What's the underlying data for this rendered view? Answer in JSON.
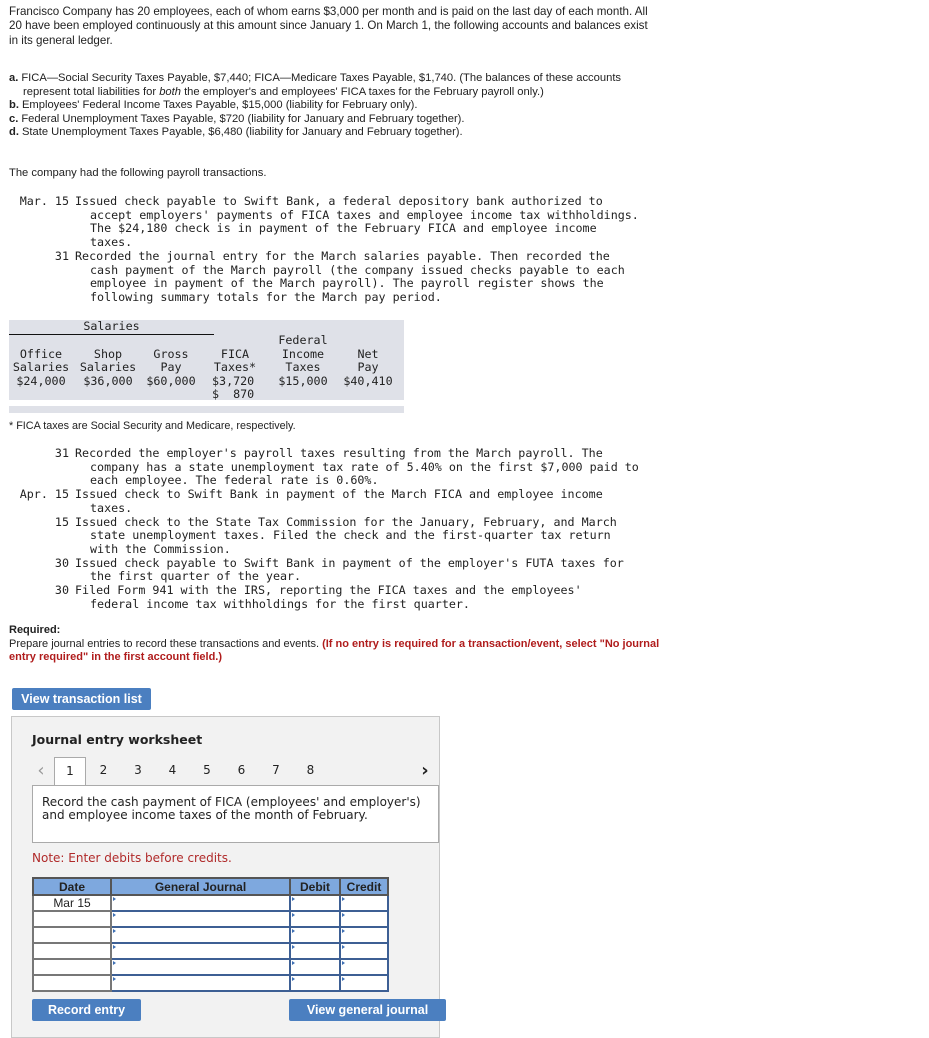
{
  "problem": {
    "intro": "Francisco Company has 20 employees, each of whom earns $3,000 per month and is paid on the last day of each month. All 20 have been employed continuously at this amount since January 1. On March 1, the following accounts and balances exist in its general ledger.",
    "accounts": [
      {
        "letter": "a.",
        "text_before": "FICA—Social Security Taxes Payable, $7,440; FICA—Medicare Taxes Payable, $1,740. (The balances of these accounts represent total liabilities for ",
        "emphasis": "both",
        "text_after": " the employer's and employees' FICA taxes for the February payroll only.)"
      },
      {
        "letter": "b.",
        "text": "Employees' Federal Income Taxes Payable, $15,000 (liability for February only)."
      },
      {
        "letter": "c.",
        "text": "Federal Unemployment Taxes Payable, $720 (liability for January and February together)."
      },
      {
        "letter": "d.",
        "text": "State Unemployment Taxes Payable, $6,480 (liability for January and February together)."
      }
    ],
    "transactions_lead": "The company had the following payroll transactions.",
    "transactions_a": [
      {
        "date": "Mar. 15",
        "lines": [
          "Issued check payable to Swift Bank, a federal depository bank authorized to",
          "accept employers' payments of FICA taxes and employee income tax withholdings.",
          "The $24,180 check is in payment of the February FICA and employee income",
          "taxes."
        ]
      },
      {
        "date": "31",
        "lines": [
          "Recorded the journal entry for the March salaries payable. Then recorded the",
          "cash payment of the March payroll (the company issued checks payable to each",
          "employee in payment of the March payroll). The payroll register shows the",
          "following summary totals for the March pay period."
        ]
      }
    ],
    "payroll_register": {
      "group_header": "Salaries",
      "columns": [
        {
          "header": [
            "",
            "Office",
            "Salaries"
          ],
          "values": [
            "$24,000"
          ]
        },
        {
          "header": [
            "",
            "Shop",
            "Salaries"
          ],
          "values": [
            "$36,000"
          ]
        },
        {
          "header": [
            "",
            "Gross",
            "Pay"
          ],
          "values": [
            "$60,000"
          ]
        },
        {
          "header": [
            "",
            "FICA",
            "Taxes*"
          ],
          "values": [
            "$3,720",
            "$  870"
          ]
        },
        {
          "header": [
            "Federal",
            "Income",
            "Taxes"
          ],
          "values": [
            "$15,000"
          ]
        },
        {
          "header": [
            "",
            "Net",
            "Pay"
          ],
          "values": [
            "$40,410"
          ]
        }
      ],
      "footnote": "* FICA taxes are Social Security and Medicare, respectively."
    },
    "transactions_b": [
      {
        "date": "31",
        "lines": [
          "Recorded the employer's payroll taxes resulting from the March payroll. The",
          "company has a state unemployment tax rate of 5.40% on the first $7,000 paid to",
          "each employee. The federal rate is 0.60%."
        ]
      },
      {
        "date": "Apr. 15",
        "lines": [
          "Issued check to Swift Bank in payment of the March FICA and employee income",
          "taxes."
        ]
      },
      {
        "date": "15",
        "lines": [
          "Issued check to the State Tax Commission for the January, February, and March",
          "state unemployment taxes. Filed the check and the first-quarter tax return",
          "with the Commission."
        ]
      },
      {
        "date": "30",
        "lines": [
          "Issued check payable to Swift Bank in payment of the employer's FUTA taxes for",
          "the first quarter of the year."
        ]
      },
      {
        "date": "30",
        "lines": [
          "Filed Form 941 with the IRS, reporting the FICA taxes and the employees'",
          "federal income tax withholdings for the first quarter."
        ]
      }
    ],
    "required_label": "Required:",
    "required_text": "Prepare journal entries to record these transactions and events. ",
    "required_note": "(If no entry is required for a transaction/event, select \"No journal entry required\" in the first account field.)"
  },
  "buttons": {
    "view_transaction_list": "View transaction list",
    "record_entry": "Record entry",
    "view_general_journal": "View general journal"
  },
  "worksheet": {
    "title": "Journal entry worksheet",
    "pages": [
      "1",
      "2",
      "3",
      "4",
      "5",
      "6",
      "7",
      "8"
    ],
    "active_page": "1",
    "prev_icon": "‹",
    "next_icon": "›",
    "description": "Record the cash payment of FICA (employees' and employer's) and employee income taxes of the month of February.",
    "note": "Note: Enter debits before credits.",
    "table": {
      "headers": [
        "Date",
        "General Journal",
        "Debit",
        "Credit"
      ],
      "rows": [
        {
          "date": "Mar 15",
          "account": "",
          "debit": "",
          "credit": ""
        },
        {
          "date": "",
          "account": "",
          "debit": "",
          "credit": ""
        },
        {
          "date": "",
          "account": "",
          "debit": "",
          "credit": ""
        },
        {
          "date": "",
          "account": "",
          "debit": "",
          "credit": ""
        },
        {
          "date": "",
          "account": "",
          "debit": "",
          "credit": ""
        },
        {
          "date": "",
          "account": "",
          "debit": "",
          "credit": ""
        }
      ]
    }
  },
  "colors": {
    "button_blue": "#4b7fc0",
    "table_header_blue": "#7ea8de",
    "warning_red": "#b01c1c",
    "register_bg": "#dfe1e8",
    "panel_bg": "#f2f2f2"
  }
}
